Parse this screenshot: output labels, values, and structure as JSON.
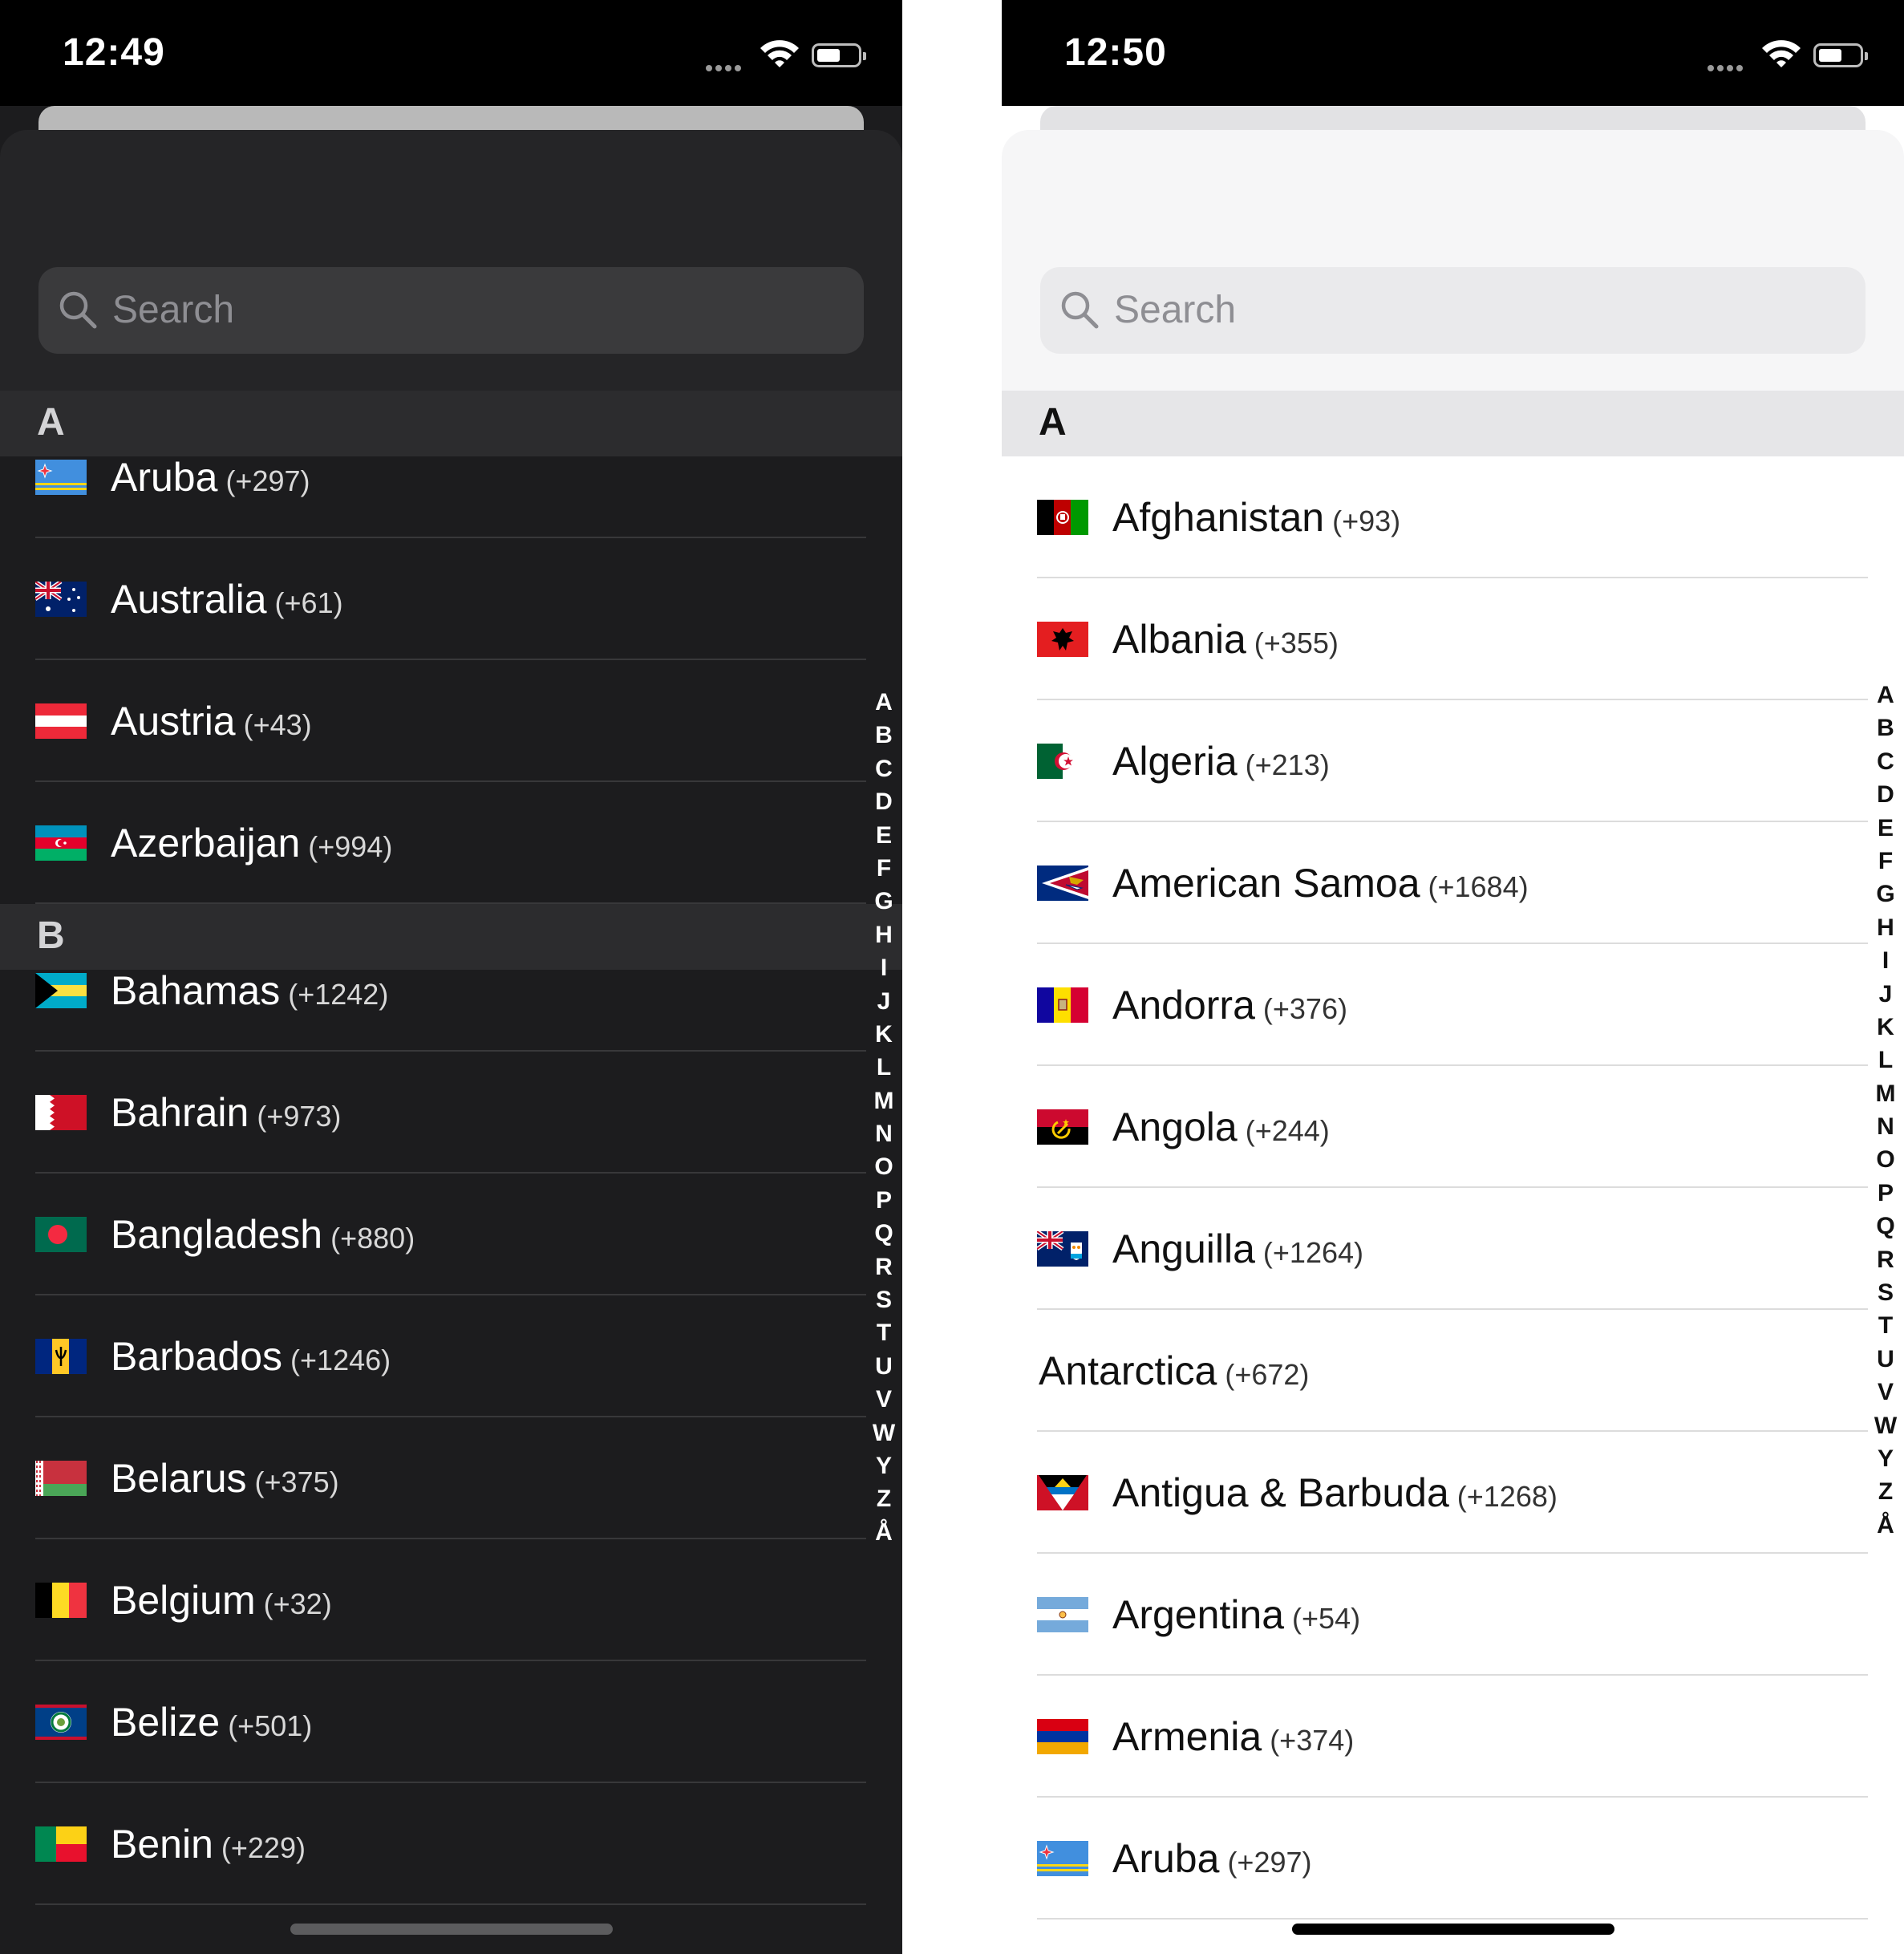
{
  "dark": {
    "time": "12:49",
    "search_placeholder": "Search",
    "sections": [
      {
        "letter": "A",
        "rows": [
          {
            "name": "Aruba",
            "code": "(+297)",
            "flag": "aruba"
          },
          {
            "name": "Australia",
            "code": "(+61)",
            "flag": "australia"
          },
          {
            "name": "Austria",
            "code": "(+43)",
            "flag": "austria"
          },
          {
            "name": "Azerbaijan",
            "code": "(+994)",
            "flag": "azerbaijan"
          }
        ]
      },
      {
        "letter": "B",
        "rows": [
          {
            "name": "Bahamas",
            "code": "(+1242)",
            "flag": "bahamas"
          },
          {
            "name": "Bahrain",
            "code": "(+973)",
            "flag": "bahrain"
          },
          {
            "name": "Bangladesh",
            "code": "(+880)",
            "flag": "bangladesh"
          },
          {
            "name": "Barbados",
            "code": "(+1246)",
            "flag": "barbados"
          },
          {
            "name": "Belarus",
            "code": "(+375)",
            "flag": "belarus"
          },
          {
            "name": "Belgium",
            "code": "(+32)",
            "flag": "belgium"
          },
          {
            "name": "Belize",
            "code": "(+501)",
            "flag": "belize"
          },
          {
            "name": "Benin",
            "code": "(+229)",
            "flag": "benin"
          }
        ]
      }
    ]
  },
  "light": {
    "time": "12:50",
    "search_placeholder": "Search",
    "sections": [
      {
        "letter": "A",
        "rows": [
          {
            "name": "Afghanistan",
            "code": "(+93)",
            "flag": "afghanistan"
          },
          {
            "name": "Albania",
            "code": "(+355)",
            "flag": "albania"
          },
          {
            "name": "Algeria",
            "code": "(+213)",
            "flag": "algeria"
          },
          {
            "name": "American Samoa",
            "code": "(+1684)",
            "flag": "american-samoa"
          },
          {
            "name": "Andorra",
            "code": "(+376)",
            "flag": "andorra"
          },
          {
            "name": "Angola",
            "code": "(+244)",
            "flag": "angola"
          },
          {
            "name": "Anguilla",
            "code": "(+1264)",
            "flag": "anguilla"
          },
          {
            "name": "Antarctica",
            "code": "(+672)",
            "flag": null
          },
          {
            "name": "Antigua & Barbuda",
            "code": "(+1268)",
            "flag": "antigua-barbuda"
          },
          {
            "name": "Argentina",
            "code": "(+54)",
            "flag": "argentina"
          },
          {
            "name": "Armenia",
            "code": "(+374)",
            "flag": "armenia"
          },
          {
            "name": "Aruba",
            "code": "(+297)",
            "flag": "aruba"
          }
        ]
      }
    ]
  },
  "index_letters": [
    "A",
    "B",
    "C",
    "D",
    "E",
    "F",
    "G",
    "H",
    "I",
    "J",
    "K",
    "L",
    "M",
    "N",
    "O",
    "P",
    "Q",
    "R",
    "S",
    "T",
    "U",
    "V",
    "W",
    "Y",
    "Z",
    "Å"
  ],
  "colors": {
    "dark_background": "#1c1c1e",
    "dark_section_header": "#2c2c2e",
    "light_background": "#ffffff",
    "light_section_header": "#e6e6e8"
  }
}
